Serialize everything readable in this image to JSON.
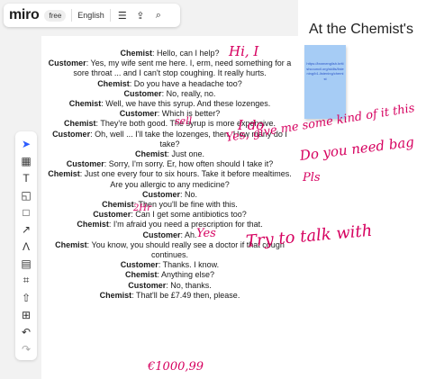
{
  "app": {
    "logo": "miro",
    "plan_badge": "free",
    "language": "English"
  },
  "board": {
    "title": "At the Chemist's",
    "sticky_note": "https://learnenglish.britishcouncil.org/skills/listening/b1-listening/chemist",
    "accent_color": "#2c5cff",
    "annotation_color": "#d6005f",
    "sticky_color": "#a6ccf5"
  },
  "toolbar_icons": [
    "menu-icon",
    "share-icon",
    "search-icon"
  ],
  "tools": [
    "select-icon",
    "frame-icon",
    "text-icon",
    "sticky-note-icon",
    "shape-icon",
    "line-icon",
    "pen-icon",
    "comment-icon",
    "frame-grid-icon",
    "upload-icon",
    "add-icon",
    "undo-icon",
    "redo-icon"
  ],
  "dialogue": [
    [
      "Chemist",
      "Hello, can I help?"
    ],
    [
      "Customer",
      "Yes, my wife sent me here. I, erm, need something for a sore throat ... and I can't stop coughing. It really hurts."
    ],
    [
      "Chemist",
      "Do you have a headache too?"
    ],
    [
      "Customer",
      "No, really, no."
    ],
    [
      "Chemist",
      "Well, we have this syrup. And these lozenges."
    ],
    [
      "Customer",
      "Which is better?"
    ],
    [
      "Chemist",
      "They're both good. The syrup is more expensive."
    ],
    [
      "Customer",
      "Oh, well ... I'll take the lozenges, then. How many do I take?"
    ],
    [
      "Chemist",
      "Just one."
    ],
    [
      "Customer",
      "Sorry, I'm sorry. Er, how often should I take it?"
    ],
    [
      "Chemist",
      "Just one every four to six hours. Take it before mealtimes. Are you allergic to any medicine?"
    ],
    [
      "Customer",
      "No."
    ],
    [
      "Chemist",
      "Then you'll be fine with this."
    ],
    [
      "Customer",
      "Can I get some antibiotics too?"
    ],
    [
      "Chemist",
      "I'm afraid you need a prescription for that."
    ],
    [
      "Customer",
      "Ah."
    ],
    [
      "Chemist",
      "You know, you should really see a doctor if that cough continues."
    ],
    [
      "Customer",
      "Thanks. I know."
    ],
    [
      "Chemist",
      "Anything else?"
    ],
    [
      "Customer",
      "No, thanks."
    ],
    [
      "Chemist",
      "That'll be £7.49 then, please."
    ]
  ],
  "annotations": {
    "a1": "Hi, I",
    "a2": "sell",
    "a3": "I do",
    "a4": "Yes, give me some kind of it this",
    "a5": "Do you need bag",
    "a6": "Pls",
    "a7": "2Hr",
    "a8": "Yes",
    "a9": "Try to talk with",
    "a10": "€1000,99"
  }
}
